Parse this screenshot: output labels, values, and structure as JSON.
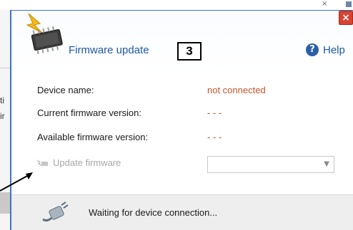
{
  "background": {
    "left_text_lines": [
      "ti",
      "ir"
    ],
    "top_close_glyph": "×"
  },
  "dialog": {
    "title": "Firmware update",
    "step_badge": "3",
    "help_label": "Help",
    "close_glyph": "×",
    "fields": {
      "device_name_label": "Device name:",
      "device_name_value": "not connected",
      "current_fw_label": "Current firmware version:",
      "current_fw_value": "- - -",
      "available_fw_label": "Available firmware version:",
      "available_fw_value": "- - -"
    },
    "update_button_label": "Update firmware",
    "version_select": {
      "selected": "",
      "arrow": "▼"
    },
    "status_text": "Waiting for device connection..."
  },
  "icons": {
    "chip": "chip-icon",
    "help": "help-icon",
    "update": "update-firmware-icon",
    "plug": "plug-icon",
    "close": "close-icon"
  },
  "colors": {
    "accent_blue": "#1d58a8",
    "value_orange": "#c4562a",
    "close_red": "#d9432f",
    "disabled_gray": "#a7a7a7",
    "status_bg": "#eeeeee"
  }
}
